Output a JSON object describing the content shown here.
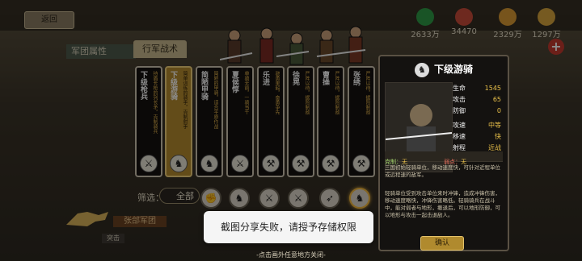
{
  "topbar": {
    "back_label": "返回",
    "resources": [
      {
        "icon": "person-icon",
        "value": "2633万",
        "color": "#2f9a45"
      },
      {
        "icon": "swords-icon",
        "value": "34470",
        "color": "#c94b3a"
      },
      {
        "icon": "wheat-icon",
        "value": "2329万",
        "color": "#d99a33"
      },
      {
        "icon": "coin-icon",
        "value": "1297万",
        "color": "#d7a53c"
      }
    ]
  },
  "tabs": {
    "active_tab": "军团属性",
    "second_tab": "行军战术"
  },
  "cards": [
    {
      "name": "下级枪兵",
      "desc": "持盾长枪的列长矛，克制骑兵"
    },
    {
      "name": "下级游骑",
      "desc": "简单训练的骑手，克制射手"
    },
    {
      "name": "简陋甲骑",
      "desc": "简陋的甲骑，适合平原作战"
    },
    {
      "name": "夏侯惇",
      "desc": "单骑无前，一骑当千"
    },
    {
      "name": "乐进",
      "desc": "骁勇果毅，奋勇争先"
    },
    {
      "name": "徐晃",
      "desc": "严阵以待，据险制敌"
    },
    {
      "name": "曹操",
      "desc": "严阵以待，据险制敌"
    },
    {
      "name": "张绣",
      "desc": "严阵以待，据险制敌"
    }
  ],
  "filter": {
    "label": "筛选：",
    "value": "全部"
  },
  "legion_label": "张郃军团",
  "small_tab": "突击",
  "panel": {
    "title": "下级游骑",
    "stats": [
      {
        "label": "生命",
        "value": "1545"
      },
      {
        "label": "攻击",
        "value": "65"
      },
      {
        "label": "防御",
        "value": "0"
      },
      {
        "label": "攻速",
        "value": "中等"
      },
      {
        "label": "移速",
        "value": "快"
      },
      {
        "label": "射程",
        "value": "近战"
      }
    ],
    "counter_label": "克制：",
    "counter_value": "无",
    "weak_label": "弱点：",
    "weak_value": "无",
    "para1": "三国初始轻骑单位，移动速度快，可针对近程单位或远程速的敌军。",
    "para2": "轻骑单位受到攻击单位来时冲锋，造成冲锋伤害，移动速度略快，冲锋伤害略低。轻骑骑兵在战斗中，能对弱者与地形，撤退后，可以地形防御，可以地形与攻击一起击退敌人。",
    "confirm_label": "确认"
  },
  "toast": "截图分享失败，请授予存储权限",
  "footer": "-点击画外任意地方关闭-"
}
